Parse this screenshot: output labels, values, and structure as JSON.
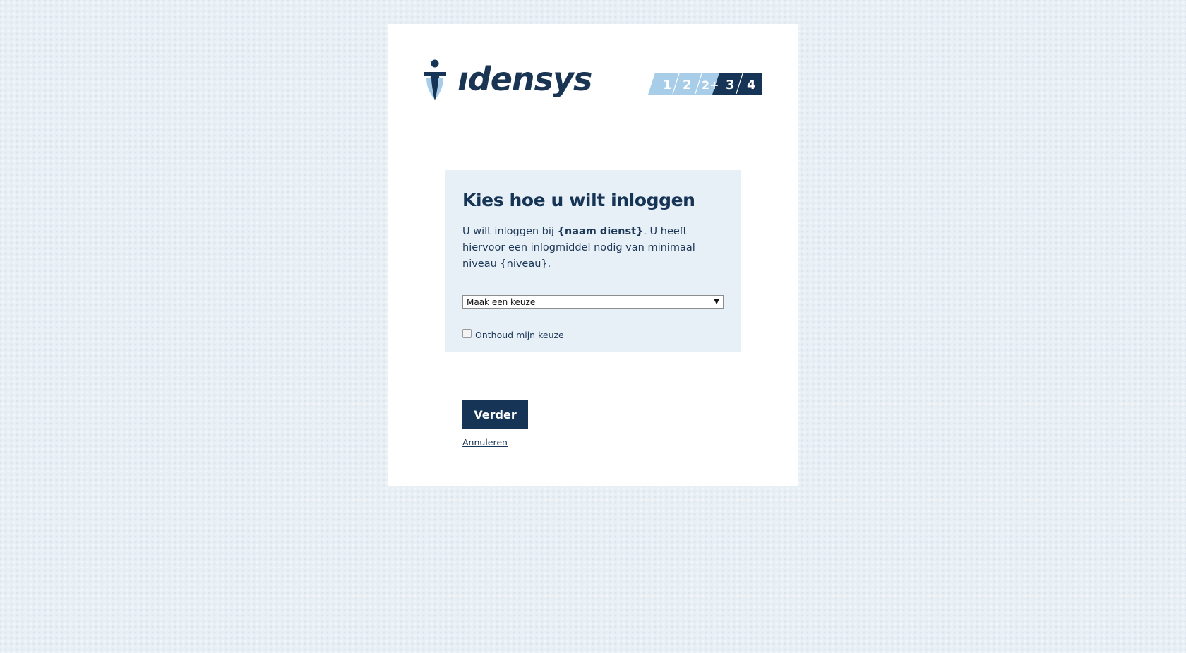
{
  "brand": {
    "logo_text": "ıdensys",
    "logo_icon": "idensys-figure-logo",
    "primary_color": "#163456",
    "light_blue": "#a8cde8"
  },
  "levels": {
    "items": [
      "1",
      "2",
      "2+",
      "3",
      "4"
    ],
    "active_from": "3"
  },
  "panel": {
    "title": "Kies hoe u wilt inloggen",
    "intro_part1": "U wilt inloggen bij ",
    "intro_bold": "{naam dienst}",
    "intro_part2": ". U heeft hiervoor een inlogmiddel nodig van minimaal niveau {niveau}.",
    "select_value": "Maak een keuze",
    "remember_label": "Onthoud mijn keuze"
  },
  "actions": {
    "continue_label": "Verder",
    "cancel_label": "Annuleren"
  }
}
